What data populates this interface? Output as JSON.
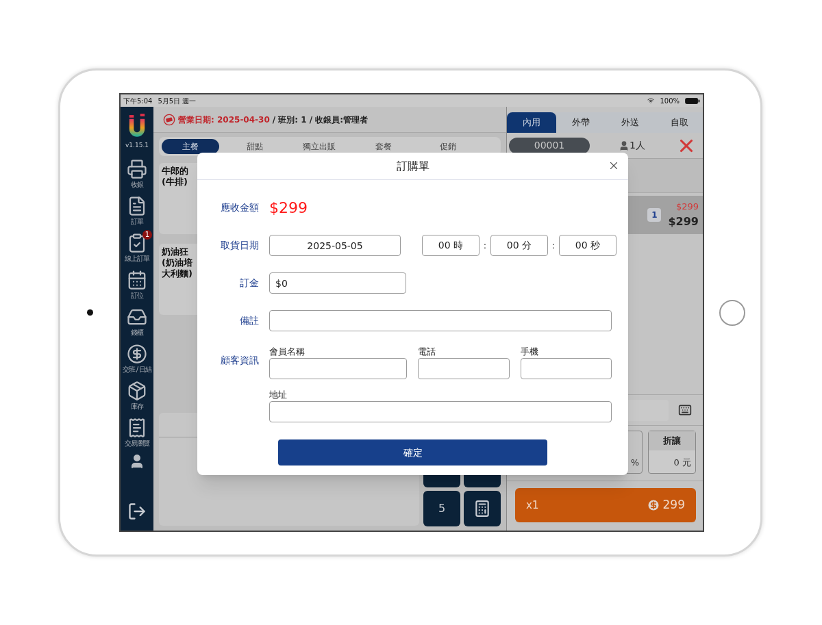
{
  "status_bar": {
    "time": "下午5:04",
    "date": "5月5日 週一",
    "battery": "100%"
  },
  "sidebar": {
    "version": "v1.15.1",
    "items": [
      {
        "label": "收銀"
      },
      {
        "label": "訂單"
      },
      {
        "label": "線上訂單",
        "badge": "1"
      },
      {
        "label": "訂位"
      },
      {
        "label": "錢櫃"
      },
      {
        "label": "交班 / 日結"
      },
      {
        "label": "庫存"
      },
      {
        "label": "交易瀏覽"
      }
    ]
  },
  "header": {
    "business_date": "營業日期: 2025-04-30",
    "shift_cashier": "/ 班別: 1 / 收銀員:管理者"
  },
  "categories": [
    {
      "label": "主餐",
      "selected": true
    },
    {
      "label": "甜點",
      "selected": false
    },
    {
      "label": "獨立出販",
      "selected": false
    },
    {
      "label": "套餐",
      "selected": false
    },
    {
      "label": "促銷",
      "selected": false
    }
  ],
  "products": [
    {
      "lines": [
        "牛郎的",
        "(牛排)"
      ]
    },
    {
      "lines": [
        "奶油狂",
        "(奶油培",
        "大利麵)"
      ]
    }
  ],
  "numpad": {
    "keys": [
      "5"
    ]
  },
  "order_types": [
    {
      "label": "內用",
      "selected": true
    },
    {
      "label": "外帶",
      "selected": false
    },
    {
      "label": "外送",
      "selected": false
    },
    {
      "label": "自取",
      "selected": false
    }
  ],
  "order": {
    "number": "00001",
    "guests": "1人",
    "items": [
      {
        "original_price": "$299",
        "quantity": "1",
        "price": "$299"
      }
    ]
  },
  "percent": "%",
  "discount": {
    "label": "折讓",
    "value": "0 元"
  },
  "checkout": {
    "count": "x1",
    "total": "299"
  },
  "dialog": {
    "title": "訂購單",
    "amount_label": "應收金額",
    "amount": "$299",
    "pickup_label": "取貨日期",
    "pickup_date": "2025-05-05",
    "time_parts": [
      "00 時",
      "00 分",
      "00 秒"
    ],
    "time_separators": [
      ":",
      ":"
    ],
    "deposit_label": "訂金",
    "deposit": "$0",
    "note_label": "備註",
    "customer_label": "顧客資訊",
    "customer_fields": [
      {
        "label": "會員名稱"
      },
      {
        "label": "電話"
      },
      {
        "label": "手機"
      },
      {
        "label": "地址"
      }
    ],
    "confirm": "確定"
  }
}
